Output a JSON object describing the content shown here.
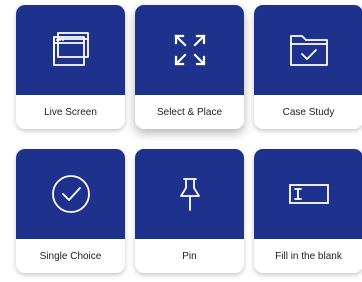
{
  "theme": {
    "tile_color": "#1e318c",
    "icon_color": "#ffffff",
    "label_color": "#222222"
  },
  "cards": [
    {
      "label": "Live Screen",
      "icon": "browser-window-icon"
    },
    {
      "label": "Select & Place",
      "icon": "expand-arrows-icon"
    },
    {
      "label": "Case Study",
      "icon": "folder-check-icon"
    },
    {
      "label": "Single Choice",
      "icon": "circle-check-icon"
    },
    {
      "label": "Pin",
      "icon": "pushpin-icon"
    },
    {
      "label": "Fill in the blank",
      "icon": "text-field-icon"
    }
  ]
}
